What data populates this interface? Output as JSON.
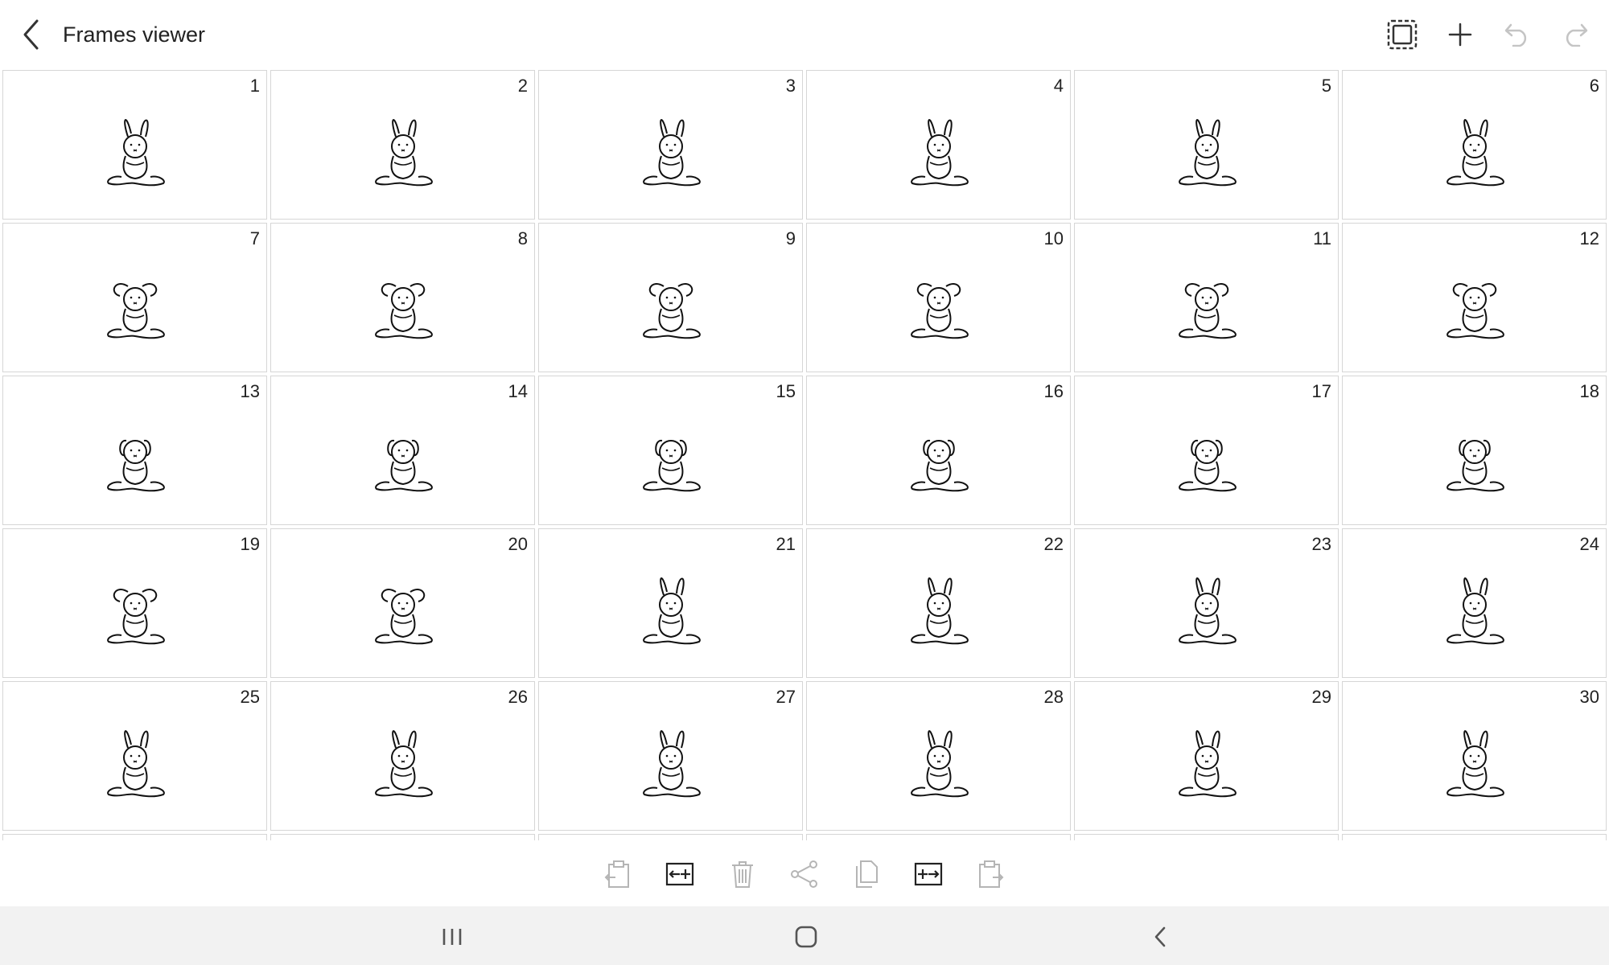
{
  "header": {
    "title": "Frames viewer",
    "icons": [
      "back-arrow-icon",
      "select-frame-icon",
      "add-icon",
      "undo-icon",
      "redo-icon"
    ]
  },
  "frames": [
    {
      "num": "1",
      "pose": "up"
    },
    {
      "num": "2",
      "pose": "up"
    },
    {
      "num": "3",
      "pose": "up"
    },
    {
      "num": "4",
      "pose": "up"
    },
    {
      "num": "5",
      "pose": "up"
    },
    {
      "num": "6",
      "pose": "up"
    },
    {
      "num": "7",
      "pose": "floppy"
    },
    {
      "num": "8",
      "pose": "floppy"
    },
    {
      "num": "9",
      "pose": "floppy"
    },
    {
      "num": "10",
      "pose": "floppy"
    },
    {
      "num": "11",
      "pose": "floppy"
    },
    {
      "num": "12",
      "pose": "floppy"
    },
    {
      "num": "13",
      "pose": "down"
    },
    {
      "num": "14",
      "pose": "down"
    },
    {
      "num": "15",
      "pose": "down"
    },
    {
      "num": "16",
      "pose": "down"
    },
    {
      "num": "17",
      "pose": "down"
    },
    {
      "num": "18",
      "pose": "down"
    },
    {
      "num": "19",
      "pose": "floppy"
    },
    {
      "num": "20",
      "pose": "floppy"
    },
    {
      "num": "21",
      "pose": "up"
    },
    {
      "num": "22",
      "pose": "up"
    },
    {
      "num": "23",
      "pose": "up"
    },
    {
      "num": "24",
      "pose": "up"
    },
    {
      "num": "25",
      "pose": "up"
    },
    {
      "num": "26",
      "pose": "up"
    },
    {
      "num": "27",
      "pose": "up"
    },
    {
      "num": "28",
      "pose": "up"
    },
    {
      "num": "29",
      "pose": "up"
    },
    {
      "num": "30",
      "pose": "up"
    }
  ],
  "toolbar": {
    "items": [
      {
        "name": "paste-before-icon",
        "enabled": false
      },
      {
        "name": "insert-before-icon",
        "enabled": true
      },
      {
        "name": "delete-icon",
        "enabled": false
      },
      {
        "name": "share-icon",
        "enabled": false
      },
      {
        "name": "copy-icon",
        "enabled": false
      },
      {
        "name": "insert-after-icon",
        "enabled": true
      },
      {
        "name": "paste-after-icon",
        "enabled": false
      }
    ]
  },
  "navbar": {
    "icons": [
      "recent-apps-icon",
      "home-icon",
      "back-icon"
    ]
  },
  "colors": {
    "enabled": "#222222",
    "disabled": "#b5b5b5",
    "frame_border": "#d6d6d6",
    "navbar_bg": "#f2f2f2"
  }
}
